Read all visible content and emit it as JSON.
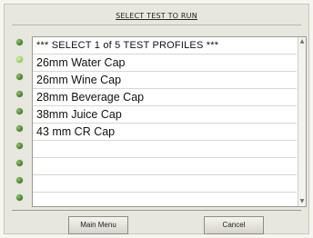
{
  "screen": {
    "title": "SELECT TEST TO RUN"
  },
  "list": {
    "header": "*** SELECT 1 of 5 TEST PROFILES ***",
    "items": [
      "26mm Water Cap",
      "26mm Wine Cap",
      "28mm Beverage Cap",
      "38mm Juice Cap",
      "43 mm CR Cap",
      "",
      "",
      "",
      ""
    ]
  },
  "indicators": {
    "count": 10,
    "active_index": 1,
    "color_on": "#7fd149",
    "color_normal": "#3e7a25"
  },
  "buttons": {
    "main_menu": "Main Menu",
    "cancel": "Cancel"
  }
}
